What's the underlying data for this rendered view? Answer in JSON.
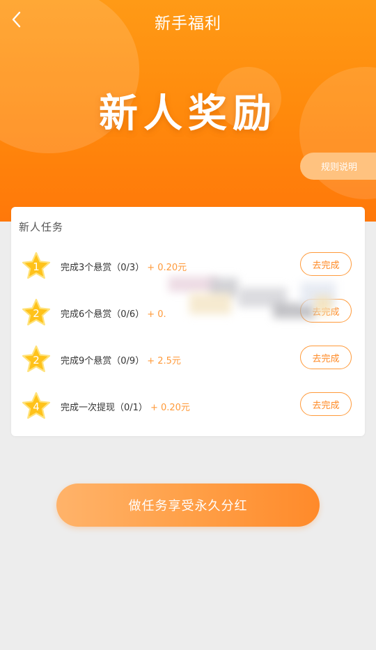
{
  "header": {
    "nav_title": "新手福利",
    "hero_title": "新人奖励",
    "rules_label": "规则说明",
    "back_icon": "chevron-left-icon"
  },
  "tasks": {
    "title": "新人任务",
    "button_label": "去完成",
    "items": [
      {
        "number": "1",
        "text": "完成3个悬赏（0/3）",
        "reward": "+ 0.20元"
      },
      {
        "number": "2",
        "text": "完成6个悬赏（0/6）",
        "reward": "+ 0."
      },
      {
        "number": "2",
        "text": "完成9个悬赏（0/9）",
        "reward": "+ 2.5元"
      },
      {
        "number": "4",
        "text": "完成一次提现（0/1）",
        "reward": "+ 0.20元"
      }
    ]
  },
  "cta": {
    "label": "做任务享受永久分红"
  },
  "colors": {
    "accent": "#ff8a0c",
    "reward": "#ff9a3a",
    "star": "#ffc21a"
  }
}
